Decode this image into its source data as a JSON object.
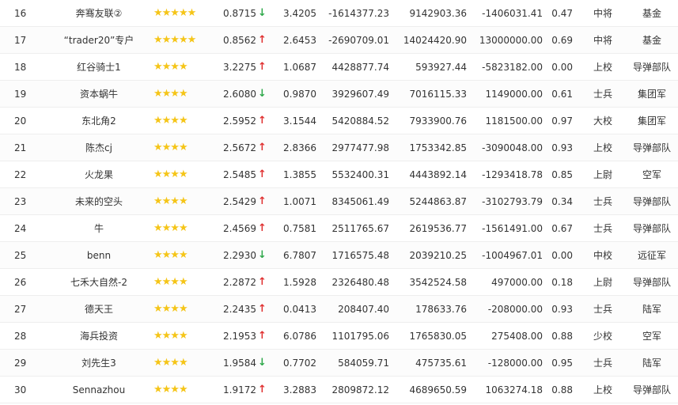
{
  "table": {
    "rows": [
      {
        "rank": "16",
        "name": "奔骞友联②",
        "stars": "★★★★★",
        "score": "0.8715",
        "trend": "down",
        "v1": "3.4205",
        "v2": "-1614377.23",
        "v3": "9142903.36",
        "v4": "-1406031.41",
        "v5": "0.47",
        "rank_name": "中将",
        "unit": "基金"
      },
      {
        "rank": "17",
        "name": "“trader20”专户",
        "stars": "★★★★★",
        "score": "0.8562",
        "trend": "up",
        "v1": "2.6453",
        "v2": "-2690709.01",
        "v3": "14024420.90",
        "v4": "13000000.00",
        "v5": "0.69",
        "rank_name": "中将",
        "unit": "基金"
      },
      {
        "rank": "18",
        "name": "红谷骑士1",
        "stars": "★★★★",
        "score": "3.2275",
        "trend": "up",
        "v1": "1.0687",
        "v2": "4428877.74",
        "v3": "593927.44",
        "v4": "-5823182.00",
        "v5": "0.00",
        "rank_name": "上校",
        "unit": "导弹部队"
      },
      {
        "rank": "19",
        "name": "资本蜗牛",
        "stars": "★★★★",
        "score": "2.6080",
        "trend": "down",
        "v1": "0.9870",
        "v2": "3929607.49",
        "v3": "7016115.33",
        "v4": "1149000.00",
        "v5": "0.61",
        "rank_name": "士兵",
        "unit": "集团军"
      },
      {
        "rank": "20",
        "name": "东北角2",
        "stars": "★★★★",
        "score": "2.5952",
        "trend": "up",
        "v1": "3.1544",
        "v2": "5420884.52",
        "v3": "7933900.76",
        "v4": "1181500.00",
        "v5": "0.97",
        "rank_name": "大校",
        "unit": "集团军"
      },
      {
        "rank": "21",
        "name": "陈杰cj",
        "stars": "★★★★",
        "score": "2.5672",
        "trend": "up",
        "v1": "2.8366",
        "v2": "2977477.98",
        "v3": "1753342.85",
        "v4": "-3090048.00",
        "v5": "0.93",
        "rank_name": "上校",
        "unit": "导弹部队"
      },
      {
        "rank": "22",
        "name": "火龙果",
        "stars": "★★★★",
        "score": "2.5485",
        "trend": "up",
        "v1": "1.3855",
        "v2": "5532400.31",
        "v3": "4443892.14",
        "v4": "-1293418.78",
        "v5": "0.85",
        "rank_name": "上尉",
        "unit": "空军"
      },
      {
        "rank": "23",
        "name": "未来的空头",
        "stars": "★★★★",
        "score": "2.5429",
        "trend": "up",
        "v1": "1.0071",
        "v2": "8345061.49",
        "v3": "5244863.87",
        "v4": "-3102793.79",
        "v5": "0.34",
        "rank_name": "士兵",
        "unit": "导弹部队"
      },
      {
        "rank": "24",
        "name": "牛",
        "stars": "★★★★",
        "score": "2.4569",
        "trend": "up",
        "v1": "0.7581",
        "v2": "2511765.67",
        "v3": "2619536.77",
        "v4": "-1561491.00",
        "v5": "0.67",
        "rank_name": "士兵",
        "unit": "导弹部队"
      },
      {
        "rank": "25",
        "name": "benn",
        "stars": "★★★★",
        "score": "2.2930",
        "trend": "down",
        "v1": "6.7807",
        "v2": "1716575.48",
        "v3": "2039210.25",
        "v4": "-1004967.01",
        "v5": "0.00",
        "rank_name": "中校",
        "unit": "远征军"
      },
      {
        "rank": "26",
        "name": "七禾大自然-2",
        "stars": "★★★★",
        "score": "2.2872",
        "trend": "up",
        "v1": "1.5928",
        "v2": "2326480.48",
        "v3": "3542524.58",
        "v4": "497000.00",
        "v5": "0.18",
        "rank_name": "上尉",
        "unit": "导弹部队"
      },
      {
        "rank": "27",
        "name": "德天王",
        "stars": "★★★★",
        "score": "2.2435",
        "trend": "up",
        "v1": "0.0413",
        "v2": "208407.40",
        "v3": "178633.76",
        "v4": "-208000.00",
        "v5": "0.93",
        "rank_name": "士兵",
        "unit": "陆军"
      },
      {
        "rank": "28",
        "name": "海兵投资",
        "stars": "★★★★",
        "score": "2.1953",
        "trend": "up",
        "v1": "6.0786",
        "v2": "1101795.06",
        "v3": "1765830.05",
        "v4": "275408.00",
        "v5": "0.88",
        "rank_name": "少校",
        "unit": "空军"
      },
      {
        "rank": "29",
        "name": "刘先生3",
        "stars": "★★★★",
        "score": "1.9584",
        "trend": "down",
        "v1": "0.7702",
        "v2": "584059.71",
        "v3": "475735.61",
        "v4": "-128000.00",
        "v5": "0.95",
        "rank_name": "士兵",
        "unit": "陆军"
      },
      {
        "rank": "30",
        "name": "Sennazhou",
        "stars": "★★★★",
        "score": "1.9172",
        "trend": "up",
        "v1": "3.2883",
        "v2": "2809872.12",
        "v3": "4689650.59",
        "v4": "1063274.18",
        "v5": "0.88",
        "rank_name": "上校",
        "unit": "导弹部队"
      }
    ],
    "arrows": {
      "up": "🡅",
      "down": "🡇"
    },
    "colors": {
      "up": "#e03030",
      "down": "#2ea84a",
      "star": "#f5c518"
    }
  }
}
